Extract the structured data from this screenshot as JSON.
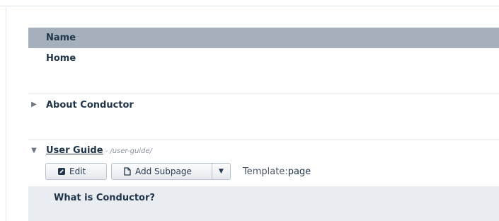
{
  "table": {
    "header_label": "Name"
  },
  "rows": [
    {
      "title": "Home"
    },
    {
      "title": "About Conductor",
      "expanded": false
    },
    {
      "title": "User Guide",
      "path": "- /user-guide/",
      "expanded": true,
      "actions": {
        "edit_label": "Edit",
        "add_subpage_label": "Add Subpage",
        "template_label": "Template:",
        "template_value": "page"
      }
    }
  ],
  "subrows": [
    {
      "title": "What is Conductor?"
    }
  ],
  "icons": {
    "collapsed": "triangle-right-icon",
    "expanded": "triangle-down-icon",
    "edit": "pencil-square-icon",
    "add_subpage": "document-icon",
    "dropdown": "caret-down-icon"
  },
  "colors": {
    "header_bg": "#a5b0bc",
    "subrow_bg": "#e9edf1",
    "text": "#1f3349"
  }
}
